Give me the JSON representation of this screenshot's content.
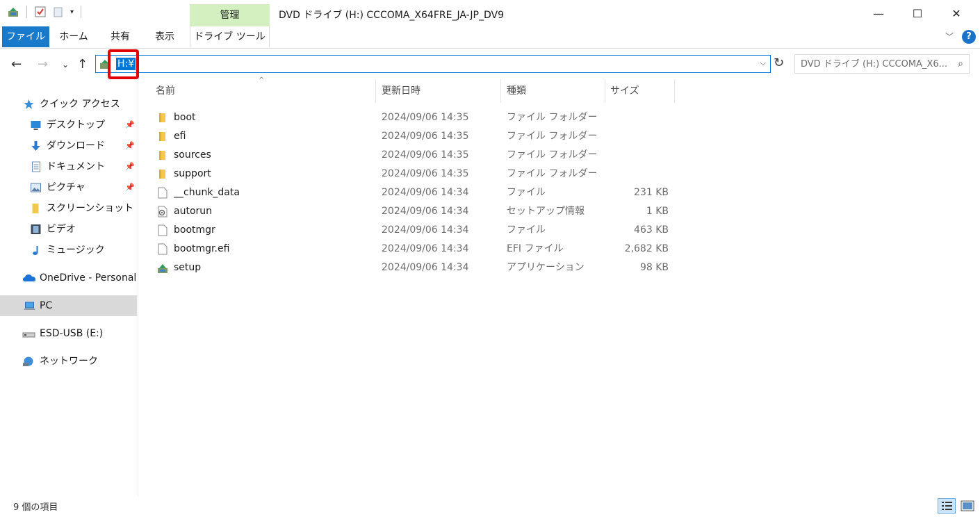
{
  "window": {
    "title": "DVD ドライブ (H:) CCCOMA_X64FRE_JA-JP_DV9",
    "minimize_glyph": "—",
    "maximize_glyph": "☐",
    "close_glyph": "✕"
  },
  "quick_access_toolbar": {
    "dropdown_glyph": "▾"
  },
  "ribbon": {
    "context_group_label": "管理",
    "tabs": {
      "file": "ファイル",
      "home": "ホーム",
      "share": "共有",
      "view": "表示",
      "drive_tools": "ドライブ ツール"
    },
    "expand_glyph": "﹀",
    "help_glyph": "?"
  },
  "navigation": {
    "back_glyph": "←",
    "forward_glyph": "→",
    "recent_glyph": "⌄",
    "up_glyph": "↑",
    "address_value": "H:¥",
    "address_dropdown_glyph": "⌵",
    "refresh_glyph": "↻",
    "search_placeholder": "DVD ドライブ (H:) CCCOMA_X6...",
    "search_glyph": "⌕"
  },
  "sidebar": {
    "quick_access": "クイック アクセス",
    "items": [
      {
        "label": "デスクトップ",
        "pinned": true
      },
      {
        "label": "ダウンロード",
        "pinned": true
      },
      {
        "label": "ドキュメント",
        "pinned": true
      },
      {
        "label": "ピクチャ",
        "pinned": true
      },
      {
        "label": "スクリーンショット",
        "pinned": false
      },
      {
        "label": "ビデオ",
        "pinned": false
      },
      {
        "label": "ミュージック",
        "pinned": false
      }
    ],
    "onedrive": "OneDrive - Personal",
    "pc": "PC",
    "usb": "ESD-USB (E:)",
    "network": "ネットワーク",
    "pin_glyph": "📌"
  },
  "file_list": {
    "columns": {
      "name": "名前",
      "date": "更新日時",
      "type": "種類",
      "size": "サイズ"
    },
    "sort_glyph": "^",
    "rows": [
      {
        "name": "boot",
        "date": "2024/09/06 14:35",
        "type": "ファイル フォルダー",
        "size": "",
        "icon": "folder-icon"
      },
      {
        "name": "efi",
        "date": "2024/09/06 14:35",
        "type": "ファイル フォルダー",
        "size": "",
        "icon": "folder-icon"
      },
      {
        "name": "sources",
        "date": "2024/09/06 14:35",
        "type": "ファイル フォルダー",
        "size": "",
        "icon": "folder-icon"
      },
      {
        "name": "support",
        "date": "2024/09/06 14:35",
        "type": "ファイル フォルダー",
        "size": "",
        "icon": "folder-icon"
      },
      {
        "name": "__chunk_data",
        "date": "2024/09/06 14:34",
        "type": "ファイル",
        "size": "231 KB",
        "icon": "file-icon"
      },
      {
        "name": "autorun",
        "date": "2024/09/06 14:34",
        "type": "セットアップ情報",
        "size": "1 KB",
        "icon": "setup-info-icon"
      },
      {
        "name": "bootmgr",
        "date": "2024/09/06 14:34",
        "type": "ファイル",
        "size": "463 KB",
        "icon": "file-icon"
      },
      {
        "name": "bootmgr.efi",
        "date": "2024/09/06 14:34",
        "type": "EFI ファイル",
        "size": "2,682 KB",
        "icon": "file-icon"
      },
      {
        "name": "setup",
        "date": "2024/09/06 14:34",
        "type": "アプリケーション",
        "size": "98 KB",
        "icon": "setup-app-icon"
      }
    ]
  },
  "status": {
    "item_count": "9 個の項目"
  },
  "colors": {
    "accent": "#0078d7",
    "file_tab": "#1979ca",
    "manage_tab": "#d4f0c0",
    "highlight": "#e00000",
    "folder": "#f2c94c"
  }
}
